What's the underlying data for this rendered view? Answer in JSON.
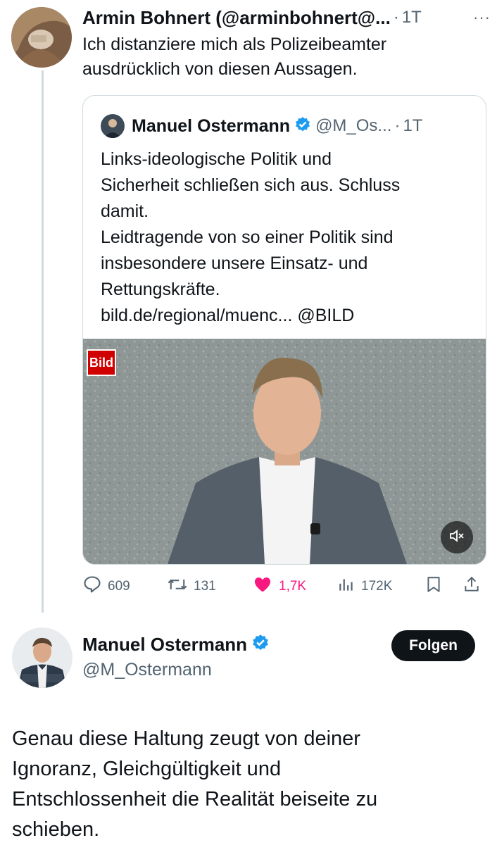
{
  "reply_tweet": {
    "author_name": "Armin Bohnert (@arminbohnert@...",
    "separator": "·",
    "time": "1T",
    "more": "···",
    "text_lines": [
      "Ich distanziere mich als Polizeibeamter",
      "ausdrücklich von diesen Aussagen."
    ]
  },
  "quoted_tweet": {
    "author_name": "Manuel Ostermann",
    "handle": "@M_Os...",
    "separator": "·",
    "time": "1T",
    "text_lines": [
      "Links-ideologische Politik und",
      "Sicherheit schließen sich aus. Schluss",
      "damit.",
      "Leidtragende von so einer Politik sind",
      "insbesondere unsere Einsatz- und",
      "Rettungskräfte.",
      "bild.de/regional/muenc... @BILD"
    ],
    "media_badge": "Bild"
  },
  "actions": {
    "replies": "609",
    "retweets": "131",
    "likes": "1,7K",
    "views": "172K"
  },
  "main_tweet": {
    "author_name": "Manuel Ostermann",
    "handle": "@M_Ostermann",
    "follow_label": "Folgen",
    "text_lines": [
      "Genau diese Haltung zeugt von deiner",
      "Ignoranz, Gleichgültigkeit und",
      "Entschlossenheit die Realität beiseite zu",
      "schieben."
    ]
  },
  "colors": {
    "verified": "#1d9bf0",
    "like": "#f91880",
    "text": "#0f1419",
    "muted": "#536471"
  }
}
